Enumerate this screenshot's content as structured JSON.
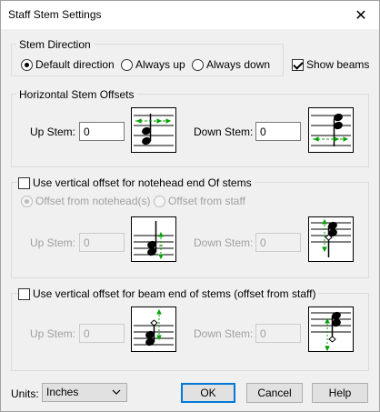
{
  "window": {
    "title": "Staff Stem Settings",
    "close_glyph": "✕"
  },
  "stem_direction": {
    "title": "Stem Direction",
    "options": [
      {
        "label": "Default direction",
        "selected": true
      },
      {
        "label": "Always up",
        "selected": false
      },
      {
        "label": "Always down",
        "selected": false
      }
    ],
    "show_beams": {
      "label": "Show beams",
      "checked": true
    }
  },
  "horizontal": {
    "title": "Horizontal Stem Offsets",
    "up_label": "Up Stem:",
    "up_value": "0",
    "down_label": "Down Stem:",
    "down_value": "0"
  },
  "notehead": {
    "checkbox_label": "Use vertical offset for notehead end Of stems",
    "checked": false,
    "radio_notehead": "Offset from notehead(s)",
    "radio_staff": "Offset from staff",
    "up_label": "Up Stem:",
    "up_value": "0",
    "down_label": "Down Stem:",
    "down_value": "0"
  },
  "beam": {
    "checkbox_label": "Use vertical offset for beam end of stems (offset from staff)",
    "checked": false,
    "up_label": "Up Stem:",
    "up_value": "0",
    "down_label": "Down Stem:",
    "down_value": "0"
  },
  "footer": {
    "units_label": "Units:",
    "units_value": "Inches",
    "ok": "OK",
    "cancel": "Cancel",
    "help": "Help"
  },
  "colors": {
    "accent": "#0078d7",
    "arrow_green": "#00a000"
  }
}
